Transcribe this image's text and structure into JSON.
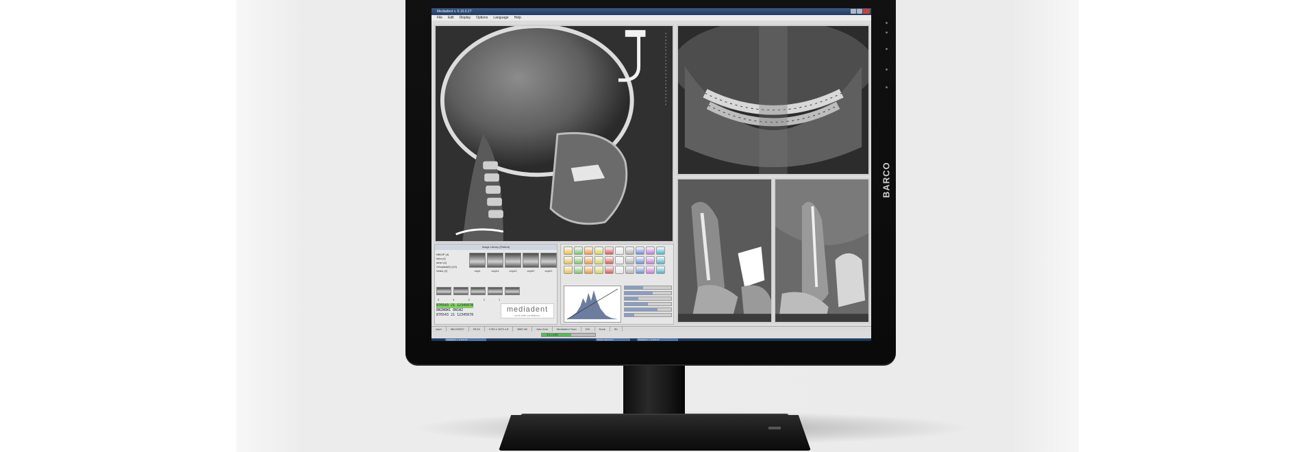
{
  "window": {
    "title": "Mediadent v. 6.10.0.27"
  },
  "menu": [
    "File",
    "Edit",
    "Display",
    "Options",
    "Language",
    "Help"
  ],
  "monitor": {
    "brand": "BARCO"
  },
  "library": {
    "header": "Image Library (Patient)",
    "tree": [
      "NBGIP (4)",
      "intra (4)",
      "other (4)",
      "Ortoplast(D) (10)",
      "Video (2)"
    ],
    "thumb_labels": [
      "ceph",
      "ceph4",
      "ceph3",
      "ceph2",
      "ceph1"
    ],
    "index_labels": [
      "5",
      "4",
      "3",
      "2",
      "1"
    ],
    "codes": [
      "876543 21 12345678",
      "8W2W8W1 8W1W2",
      "876543 21 12345678"
    ]
  },
  "logo": {
    "name": "mediadent",
    "tagline": "work with confidence"
  },
  "status": {
    "cells": [
      "ceph",
      "08/13/2007",
      "09:24",
      "1750 x 1673 x 8",
      "3887 kB",
      "John Doe",
      "Mediadent Tuan",
      "DIC",
      "Dock",
      "Sb"
    ]
  },
  "progress": {
    "label": "1:1 | 1:00",
    "value": 0.55
  },
  "taskbar": {
    "items": [
      "Mediadent v. 6.10.0.27",
      "Please wait tumin",
      "Mediadent v. 6.10.0.27"
    ]
  },
  "colors": {
    "screen_bg": "#dcdcdc",
    "titlebar": "#1f3b63",
    "code_highlight": "#7ed35a"
  }
}
